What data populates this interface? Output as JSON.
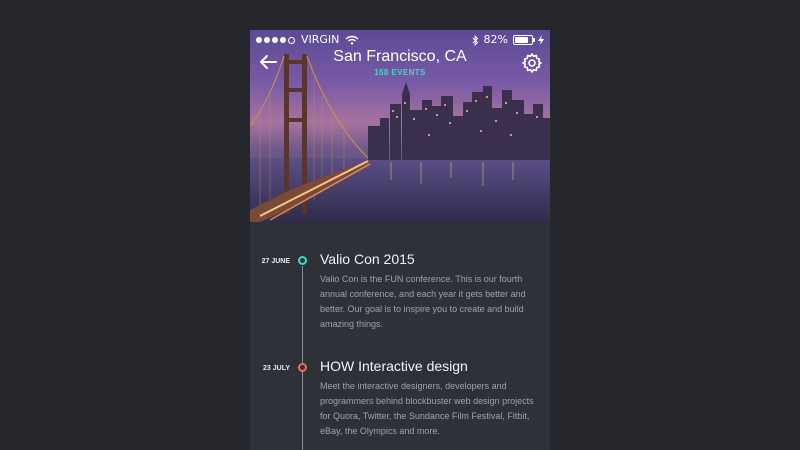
{
  "status_bar": {
    "signal_dots": 4,
    "carrier": "VIRGIN",
    "battery_percent": "82%",
    "battery_level": 0.82
  },
  "header": {
    "back_icon": "arrow-left-icon",
    "title": "San Francisco, CA",
    "subtitle": "168 EVENTS",
    "settings_icon": "gear-icon"
  },
  "colors": {
    "accent_teal": "#3ddbc8",
    "accent_orange": "#f0714a",
    "background": "#2f3139"
  },
  "events": [
    {
      "date": "27 JUNE",
      "title": "Valio Con 2015",
      "description": "Valio Con is the FUN conference. This is our fourth annual conference, and each year it gets better and better. Our goal is to inspire you to create and build amazing things.",
      "marker_color": "#3ddbc8"
    },
    {
      "date": "23 JULY",
      "title": "HOW Interactive design",
      "description": "Meet the interactive designers, developers and programmers behind blockbuster web design projects for Quora, Twitter, the Sundance Film Festival, Fitbit, eBay, the Olympics and more.",
      "marker_color": "#f0714a"
    }
  ]
}
